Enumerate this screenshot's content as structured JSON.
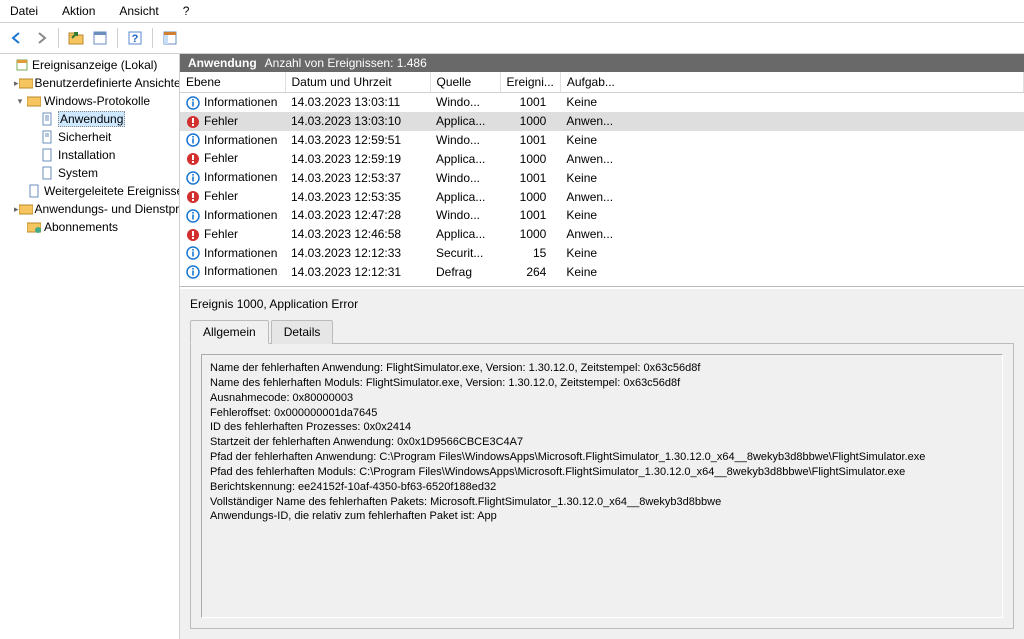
{
  "menu": {
    "file": "Datei",
    "action": "Aktion",
    "view": "Ansicht",
    "help": "?"
  },
  "tree": {
    "root": "Ereignisanzeige (Lokal)",
    "custom_views": "Benutzerdefinierte Ansichten",
    "windows_logs": "Windows-Protokolle",
    "application": "Anwendung",
    "security": "Sicherheit",
    "setup": "Installation",
    "system": "System",
    "forwarded": "Weitergeleitete Ereignisse",
    "app_services": "Anwendungs- und Dienstprotokolle",
    "subscriptions": "Abonnements"
  },
  "header": {
    "category": "Anwendung",
    "count_label": "Anzahl von Ereignissen: 1.486"
  },
  "columns": {
    "level": "Ebene",
    "datetime": "Datum und Uhrzeit",
    "source": "Quelle",
    "eventid": "Ereigni...",
    "task": "Aufgab..."
  },
  "rows": [
    {
      "level": "Informationen",
      "icon": "info",
      "dt": "14.03.2023 13:03:11",
      "src": "Windo...",
      "id": "1001",
      "task": "Keine",
      "selected": false
    },
    {
      "level": "Fehler",
      "icon": "error",
      "dt": "14.03.2023 13:03:10",
      "src": "Applica...",
      "id": "1000",
      "task": "Anwen...",
      "selected": true
    },
    {
      "level": "Informationen",
      "icon": "info",
      "dt": "14.03.2023 12:59:51",
      "src": "Windo...",
      "id": "1001",
      "task": "Keine",
      "selected": false
    },
    {
      "level": "Fehler",
      "icon": "error",
      "dt": "14.03.2023 12:59:19",
      "src": "Applica...",
      "id": "1000",
      "task": "Anwen...",
      "selected": false
    },
    {
      "level": "Informationen",
      "icon": "info",
      "dt": "14.03.2023 12:53:37",
      "src": "Windo...",
      "id": "1001",
      "task": "Keine",
      "selected": false
    },
    {
      "level": "Fehler",
      "icon": "error",
      "dt": "14.03.2023 12:53:35",
      "src": "Applica...",
      "id": "1000",
      "task": "Anwen...",
      "selected": false
    },
    {
      "level": "Informationen",
      "icon": "info",
      "dt": "14.03.2023 12:47:28",
      "src": "Windo...",
      "id": "1001",
      "task": "Keine",
      "selected": false
    },
    {
      "level": "Fehler",
      "icon": "error",
      "dt": "14.03.2023 12:46:58",
      "src": "Applica...",
      "id": "1000",
      "task": "Anwen...",
      "selected": false
    },
    {
      "level": "Informationen",
      "icon": "info",
      "dt": "14.03.2023 12:12:33",
      "src": "Securit...",
      "id": "15",
      "task": "Keine",
      "selected": false
    },
    {
      "level": "Informationen",
      "icon": "info",
      "dt": "14.03.2023 12:12:31",
      "src": "Defrag",
      "id": "264",
      "task": "Keine",
      "selected": false
    }
  ],
  "detail": {
    "title": "Ereignis 1000, Application Error",
    "tabs": {
      "general": "Allgemein",
      "details": "Details"
    },
    "lines": [
      "Name der fehlerhaften Anwendung: FlightSimulator.exe, Version: 1.30.12.0, Zeitstempel: 0x63c56d8f",
      "Name des fehlerhaften Moduls: FlightSimulator.exe, Version: 1.30.12.0, Zeitstempel: 0x63c56d8f",
      "Ausnahmecode: 0x80000003",
      "Fehleroffset: 0x000000001da7645",
      "ID des fehlerhaften Prozesses: 0x0x2414",
      "Startzeit der fehlerhaften Anwendung: 0x0x1D9566CBCE3C4A7",
      "Pfad der fehlerhaften Anwendung: C:\\Program Files\\WindowsApps\\Microsoft.FlightSimulator_1.30.12.0_x64__8wekyb3d8bbwe\\FlightSimulator.exe",
      "Pfad des fehlerhaften Moduls: C:\\Program Files\\WindowsApps\\Microsoft.FlightSimulator_1.30.12.0_x64__8wekyb3d8bbwe\\FlightSimulator.exe",
      "Berichtskennung: ee24152f-10af-4350-bf63-6520f188ed32",
      "Vollständiger Name des fehlerhaften Pakets: Microsoft.FlightSimulator_1.30.12.0_x64__8wekyb3d8bbwe",
      "Anwendungs-ID, die relativ zum fehlerhaften Paket ist: App"
    ]
  }
}
